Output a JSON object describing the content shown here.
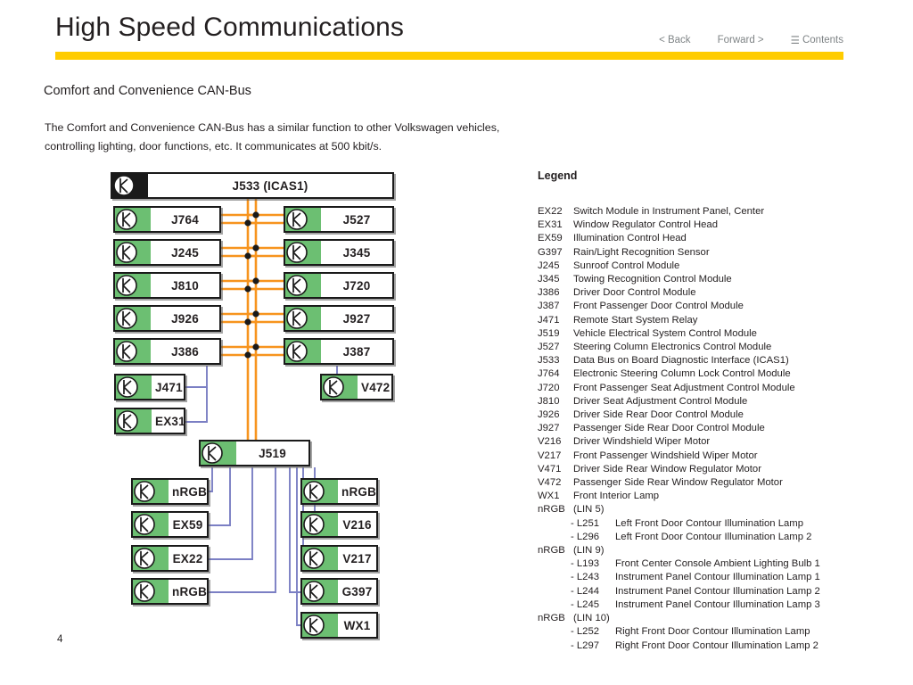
{
  "header": {
    "title": "High Speed Communications",
    "rule_color": "#FFCC00",
    "nav": {
      "back": "< Back",
      "forward": "Forward >",
      "contents_icon": "hamburger-menu-icon",
      "contents": "Contents",
      "contents_glyph": "☰"
    }
  },
  "content": {
    "section_title": "Comfort and Convenience CAN-Bus",
    "paragraph": "The Comfort and Convenience CAN-Bus has a similar function to other Volkswagen vehicles, controlling lighting, door functions, etc.  It communicates at 500 kbit/s."
  },
  "diagram": {
    "node_icon": "can-node-icon",
    "colors": {
      "node_green": "#6CBF72",
      "node_dark": "#1A1A1A",
      "bus_orange": "#F7941E",
      "lin_violet": "#7B7FC4",
      "node_border": "#1A1A1A"
    },
    "nodes": {
      "gateway": "J533 (ICAS1)",
      "left_bus": [
        "J764",
        "J245",
        "J810",
        "J926",
        "J386"
      ],
      "right_bus": [
        "J527",
        "J345",
        "J720",
        "J927",
        "J387"
      ],
      "left_sub": [
        "J471",
        "EX31"
      ],
      "right_sub": [
        "V472"
      ],
      "hub": "J519",
      "lin_left": [
        "nRGB",
        "EX59",
        "EX22",
        "nRGB"
      ],
      "lin_right": [
        "nRGB",
        "V216",
        "V217",
        "G397",
        "WX1"
      ]
    }
  },
  "legend": {
    "heading": "Legend",
    "entries": [
      {
        "code": "EX22",
        "desc": "Switch Module in Instrument Panel, Center"
      },
      {
        "code": "EX31",
        "desc": "Window Regulator Control Head"
      },
      {
        "code": "EX59",
        "desc": "Illumination Control Head"
      },
      {
        "code": "G397",
        "desc": "Rain/Light Recognition Sensor"
      },
      {
        "code": "J245",
        "desc": "Sunroof Control Module"
      },
      {
        "code": "J345",
        "desc": "Towing Recognition Control Module"
      },
      {
        "code": "J386",
        "desc": "Driver Door Control Module"
      },
      {
        "code": "J387",
        "desc": "Front Passenger Door Control Module"
      },
      {
        "code": "J471",
        "desc": "Remote Start System Relay"
      },
      {
        "code": "J519",
        "desc": "Vehicle Electrical System Control Module"
      },
      {
        "code": "J527",
        "desc": "Steering Column Electronics Control Module"
      },
      {
        "code": "J533",
        "desc": "Data Bus on Board Diagnostic Interface (ICAS1)"
      },
      {
        "code": "J764",
        "desc": "Electronic Steering Column Lock Control Module"
      },
      {
        "code": "J720",
        "desc": "Front Passenger Seat Adjustment Control Module"
      },
      {
        "code": "J810",
        "desc": "Driver Seat Adjustment Control Module"
      },
      {
        "code": "J926",
        "desc": "Driver Side Rear Door Control Module"
      },
      {
        "code": "J927",
        "desc": "Passenger Side Rear Door Control Module"
      },
      {
        "code": "V216",
        "desc": "Driver Windshield Wiper Motor"
      },
      {
        "code": "V217",
        "desc": "Front Passenger Windshield Wiper Motor"
      },
      {
        "code": "V471",
        "desc": "Driver Side Rear Window Regulator Motor"
      },
      {
        "code": "V472",
        "desc": "Passenger Side Rear Window Regulator Motor"
      },
      {
        "code": "WX1",
        "desc": "Front Interior Lamp"
      },
      {
        "code": "nRGB",
        "desc": "(LIN 5)"
      },
      {
        "sub": true,
        "code": "- L251",
        "desc": "Left Front Door Contour Illumination Lamp"
      },
      {
        "sub": true,
        "code": "- L296",
        "desc": "Left Front Door Contour Illumination Lamp 2"
      },
      {
        "code": "nRGB",
        "desc": "(LIN 9)"
      },
      {
        "sub": true,
        "code": "- L193",
        "desc": "Front Center Console Ambient Lighting Bulb 1"
      },
      {
        "sub": true,
        "code": "- L243",
        "desc": "Instrument Panel Contour Illumination Lamp 1"
      },
      {
        "sub": true,
        "code": "- L244",
        "desc": "Instrument Panel Contour Illumination Lamp 2"
      },
      {
        "sub": true,
        "code": "- L245",
        "desc": "Instrument Panel Contour Illumination Lamp 3"
      },
      {
        "code": "nRGB",
        "desc": "(LIN 10)"
      },
      {
        "sub": true,
        "code": "- L252",
        "desc": "Right Front Door Contour Illumination Lamp"
      },
      {
        "sub": true,
        "code": "- L297",
        "desc": "Right Front Door Contour Illumination Lamp 2"
      }
    ]
  },
  "footer": {
    "page_number": "4"
  }
}
